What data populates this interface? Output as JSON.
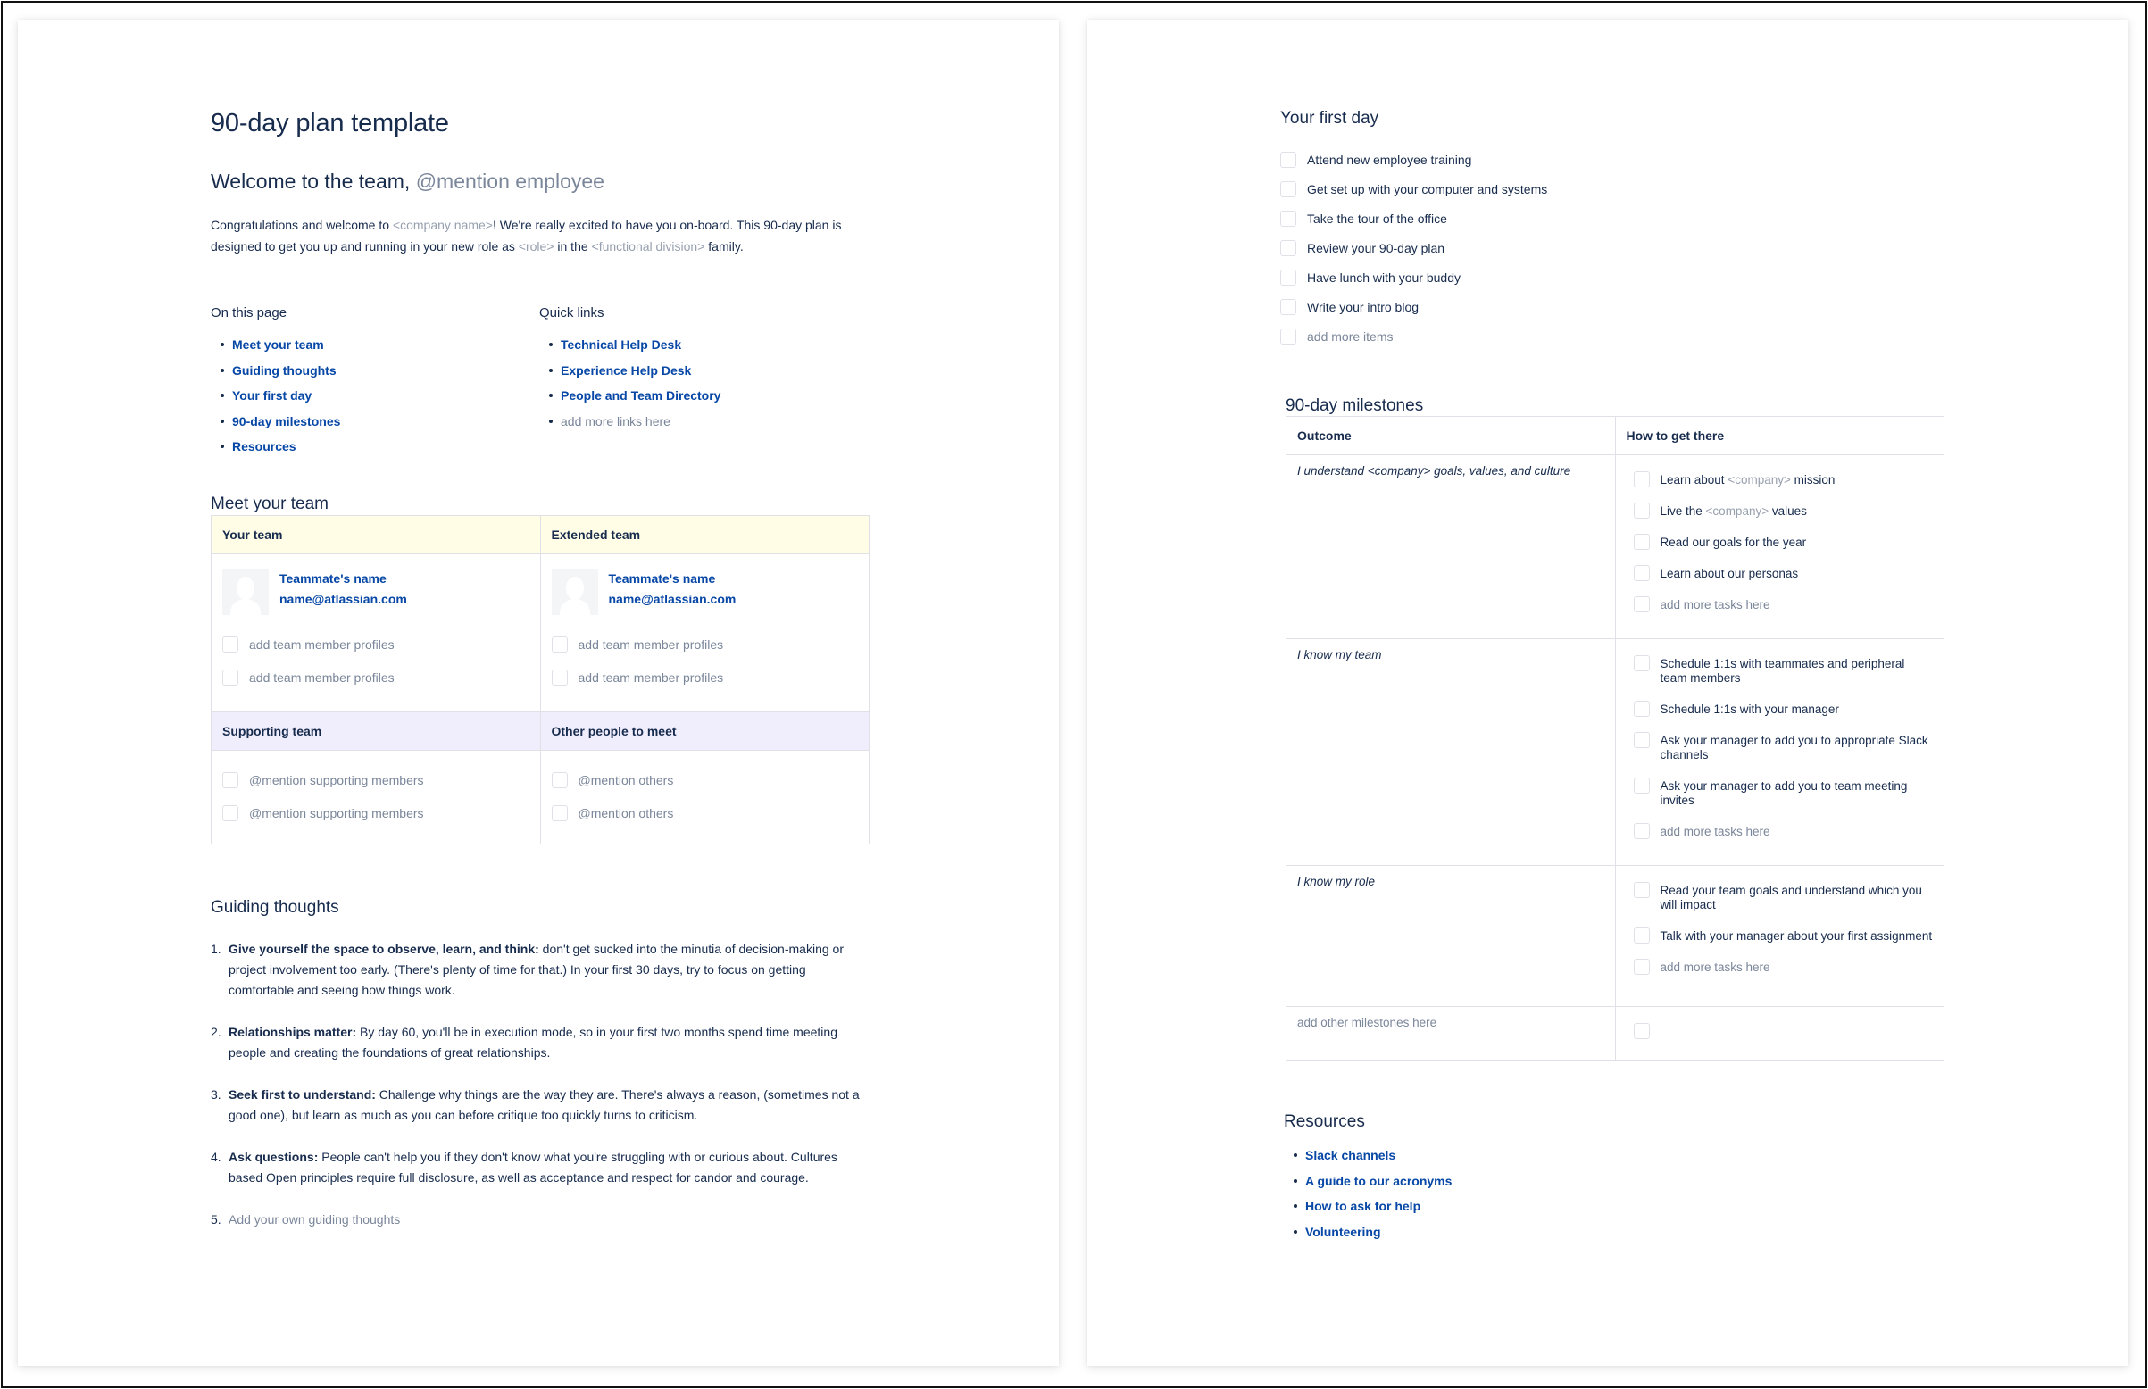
{
  "left_page": {
    "title": "90-day plan template",
    "welcome": {
      "heading": "Welcome to the team,",
      "mention": "@mention employee"
    },
    "intro": {
      "part1": "Congratulations and welcome to ",
      "company_placeholder": "<company name>",
      "part2": "! We're really excited to have you on-board. This 90-day plan is designed to get you up and running in your new role as ",
      "role_placeholder": "<role>",
      "part3": " in the ",
      "division_placeholder": "<functional division>",
      "part4": " family."
    },
    "on_this_page": {
      "heading": "On this page",
      "items": [
        "Meet your team",
        "Guiding thoughts",
        "Your first day",
        "90-day milestones",
        "Resources"
      ]
    },
    "quick_links": {
      "heading": "Quick links",
      "items": [
        "Technical Help Desk",
        "Experience Help Desk",
        "People and Team Directory"
      ],
      "placeholder": "add more links here"
    },
    "meet_team": {
      "heading": "Meet your team",
      "columns": [
        {
          "header": "Your team",
          "profile_name": "Teammate's name",
          "profile_email": "name@atlassian.com",
          "items": [
            "add team member profiles",
            "add team member profiles"
          ]
        },
        {
          "header": "Extended team",
          "profile_name": "Teammate's name",
          "profile_email": "name@atlassian.com",
          "items": [
            "add team member profiles",
            "add team member profiles"
          ]
        }
      ],
      "second_row": [
        {
          "header": "Supporting team",
          "items": [
            "@mention supporting members",
            "@mention supporting members"
          ]
        },
        {
          "header": "Other people to meet",
          "items": [
            "@mention others",
            "@mention others"
          ]
        }
      ]
    },
    "guiding": {
      "heading": "Guiding thoughts",
      "items": [
        {
          "num": "1.",
          "bold": "Give yourself the space to observe, learn, and think:",
          "text": " don't get sucked into the minutia of decision-making or project involvement too early. (There's plenty of time for that.) In your first 30 days, try to focus on getting comfortable and seeing how things work."
        },
        {
          "num": "2.",
          "bold": "Relationships matter:",
          "text": " By day 60, you'll be in execution mode, so in your first two months spend time meeting people and creating the foundations of great relationships."
        },
        {
          "num": "3.",
          "bold": "Seek first to understand:",
          "text": " Challenge why things are the way they are. There's always a reason, (sometimes not a good one), but learn as much as you can before critique too quickly turns to criticism."
        },
        {
          "num": "4.",
          "bold": "Ask questions:",
          "text": " People can't help you if they don't know what you're struggling with or curious about. Cultures based Open principles require full disclosure, as well as acceptance and respect for candor and courage."
        }
      ],
      "placeholder_num": "5.",
      "placeholder": "Add your own guiding thoughts"
    }
  },
  "right_page": {
    "first_day": {
      "heading": "Your first day",
      "items": [
        "Attend new employee training",
        "Get set up with your computer and systems",
        "Take the tour of the office",
        "Review your 90-day plan",
        "Have lunch with your buddy",
        "Write your intro blog"
      ],
      "placeholder": "add more items"
    },
    "milestones": {
      "heading": "90-day milestones",
      "col_outcome": "Outcome",
      "col_how": "How to get there",
      "rows": [
        {
          "outcome": "I understand <company> goals, values, and culture",
          "tasks": [
            {
              "pre": "Learn about ",
              "ph": "<company>",
              "post": " mission"
            },
            {
              "pre": "Live the ",
              "ph": "<company>",
              "post": " values"
            },
            {
              "pre": "Read our goals for the year",
              "ph": "",
              "post": ""
            },
            {
              "pre": "Learn about our personas",
              "ph": "",
              "post": ""
            }
          ],
          "placeholder": "add more tasks here"
        },
        {
          "outcome": "I know my team",
          "tasks": [
            {
              "pre": "Schedule 1:1s with teammates and peripheral team members",
              "ph": "",
              "post": ""
            },
            {
              "pre": "Schedule 1:1s with your manager",
              "ph": "",
              "post": ""
            },
            {
              "pre": "Ask your manager to add you to appropriate Slack channels",
              "ph": "",
              "post": ""
            },
            {
              "pre": "Ask your manager to add you to team meeting invites",
              "ph": "",
              "post": ""
            }
          ],
          "placeholder": "add more tasks here"
        },
        {
          "outcome": "I know my role",
          "tasks": [
            {
              "pre": "Read your team goals and understand which you will impact",
              "ph": "",
              "post": ""
            },
            {
              "pre": "Talk with your manager about your first assignment",
              "ph": "",
              "post": ""
            }
          ],
          "placeholder": "add more tasks here"
        }
      ],
      "add_row_placeholder": "add other milestones here"
    },
    "resources": {
      "heading": "Resources",
      "items": [
        "Slack channels",
        "A guide to our acronyms",
        "How to ask for help",
        "Volunteering"
      ]
    }
  }
}
